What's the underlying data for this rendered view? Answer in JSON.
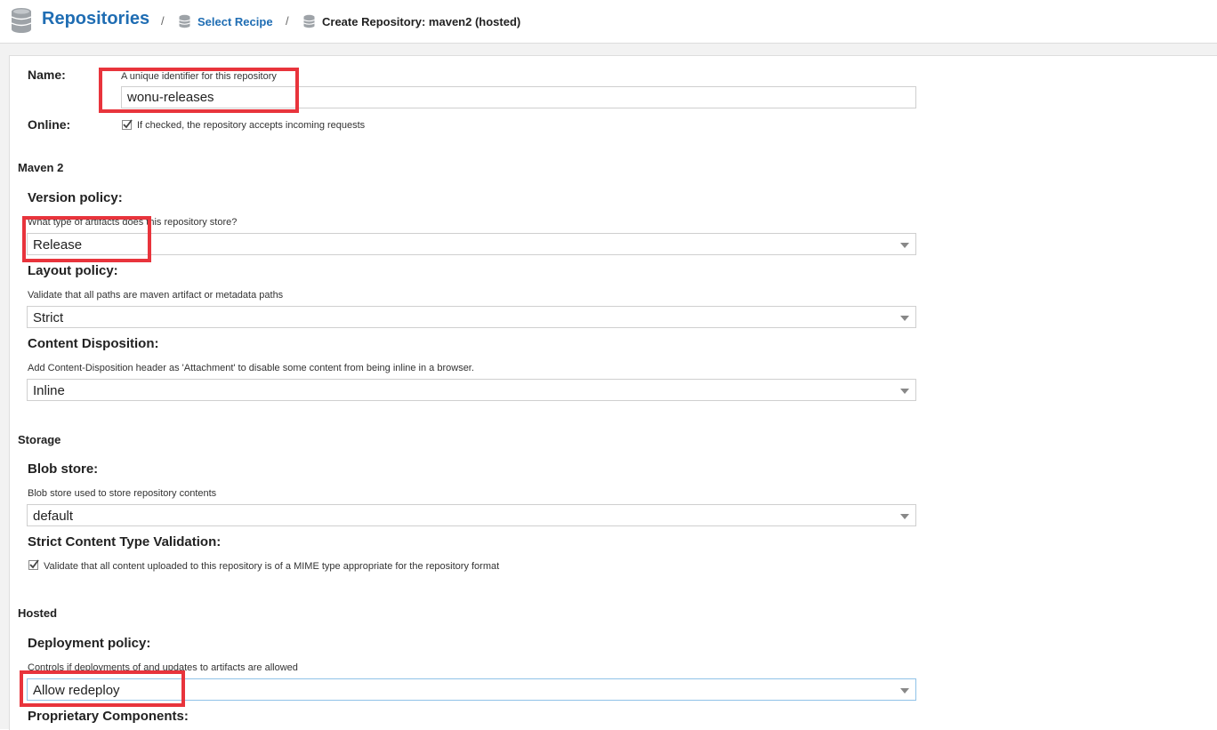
{
  "header": {
    "title": "Repositories",
    "separator": "/",
    "crumb_select_recipe": "Select Recipe",
    "crumb_current": "Create Repository: maven2 (hosted)"
  },
  "form": {
    "name": {
      "label": "Name:",
      "help": "A unique identifier for this repository",
      "value": "wonu-releases"
    },
    "online": {
      "label": "Online:",
      "help": "If checked, the repository accepts incoming requests",
      "checked": true
    },
    "maven_section": "Maven 2",
    "version_policy": {
      "label": "Version policy:",
      "help": "What type of artifacts does this repository store?",
      "value": "Release"
    },
    "layout_policy": {
      "label": "Layout policy:",
      "help": "Validate that all paths are maven artifact or metadata paths",
      "value": "Strict"
    },
    "content_disposition": {
      "label": "Content Disposition:",
      "help": "Add Content-Disposition header as 'Attachment' to disable some content from being inline in a browser.",
      "value": "Inline"
    },
    "storage_section": "Storage",
    "blob_store": {
      "label": "Blob store:",
      "help": "Blob store used to store repository contents",
      "value": "default"
    },
    "strict_content": {
      "label": "Strict Content Type Validation:",
      "help": "Validate that all content uploaded to this repository is of a MIME type appropriate for the repository format",
      "checked": true
    },
    "hosted_section": "Hosted",
    "deployment_policy": {
      "label": "Deployment policy:",
      "help": "Controls if deployments of and updates to artifacts are allowed",
      "value": "Allow redeploy"
    },
    "proprietary": {
      "label": "Proprietary Components:"
    }
  },
  "colors": {
    "accent": "#1f6db3",
    "annotation": "#e8343c"
  },
  "icons": {
    "header": "database-icon",
    "crumb": "database-icon",
    "dropdown": "caret-down-icon",
    "checkbox": "checkmark-icon"
  }
}
